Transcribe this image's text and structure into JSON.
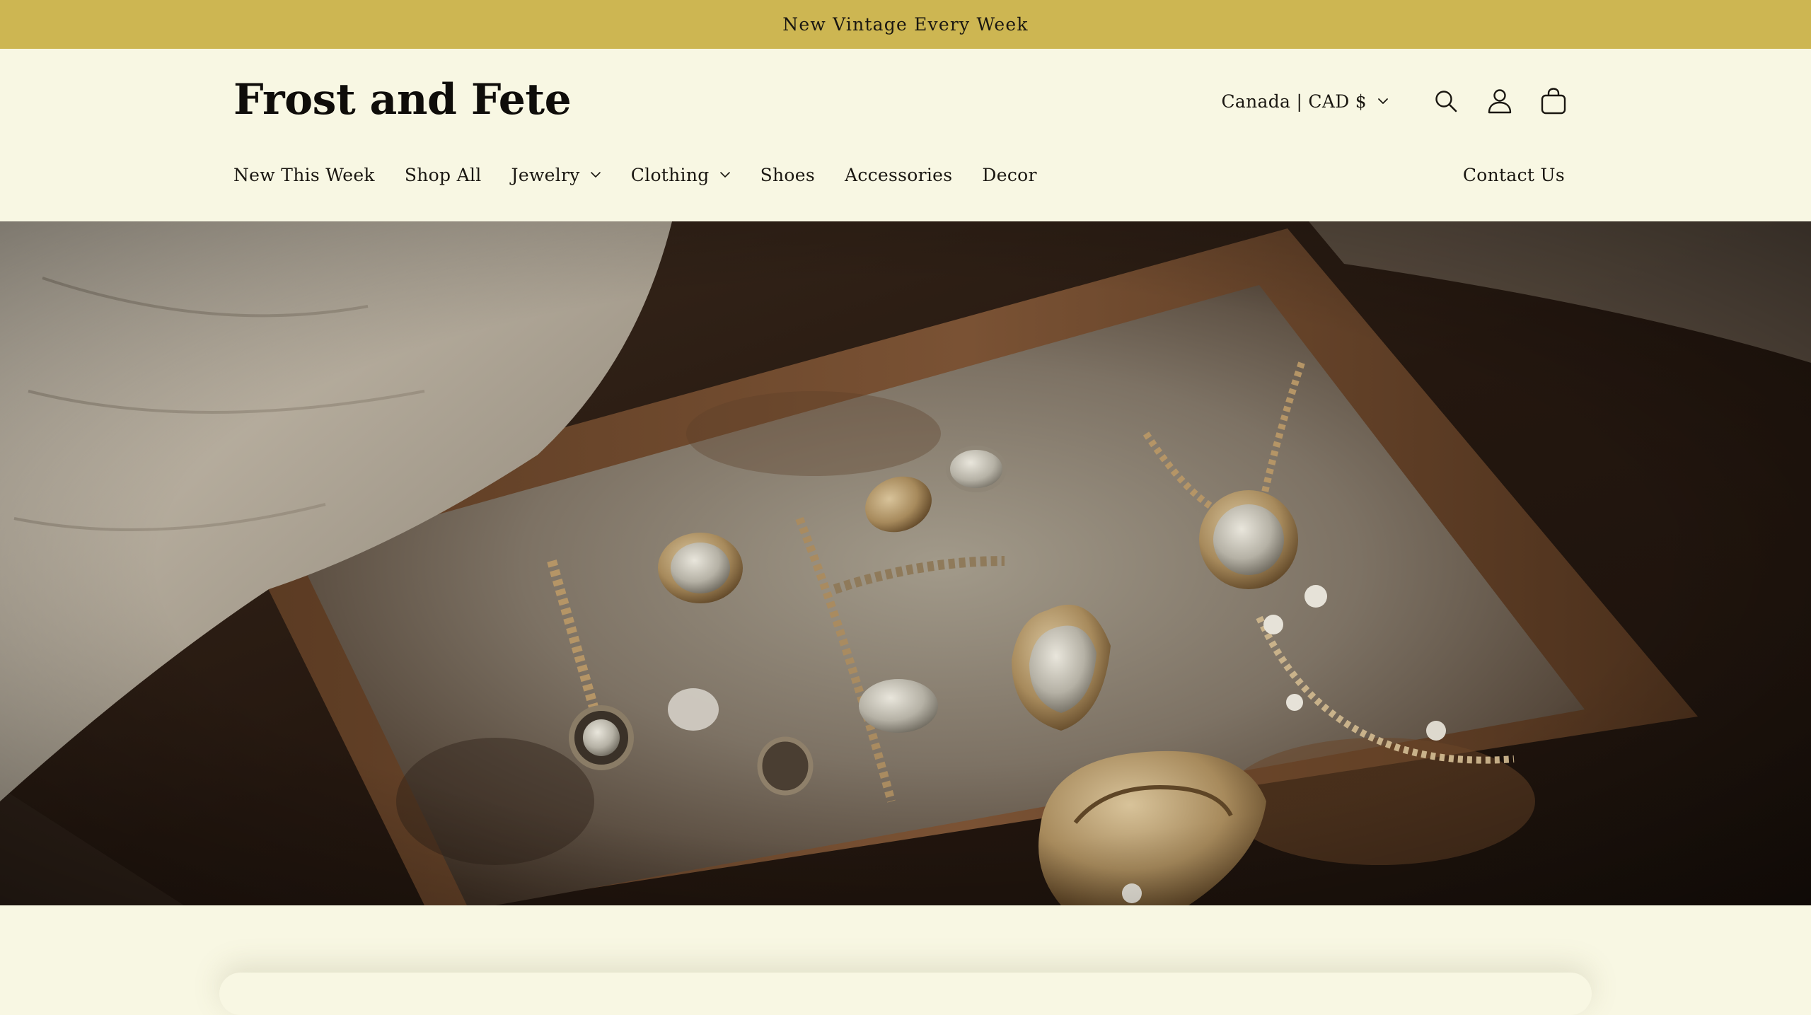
{
  "announcement": {
    "text": "New Vintage Every Week"
  },
  "header": {
    "logo": "Frost and Fete",
    "country_selector": "Canada | CAD $",
    "icons": [
      "search-icon",
      "account-icon",
      "cart-icon"
    ]
  },
  "nav": {
    "items": [
      {
        "label": "New This Week",
        "has_dropdown": false
      },
      {
        "label": "Shop All",
        "has_dropdown": false
      },
      {
        "label": "Jewelry",
        "has_dropdown": true
      },
      {
        "label": "Clothing",
        "has_dropdown": true
      },
      {
        "label": "Shoes",
        "has_dropdown": false
      },
      {
        "label": "Accessories",
        "has_dropdown": false
      },
      {
        "label": "Decor",
        "has_dropdown": false
      }
    ],
    "right_item": "Contact Us"
  },
  "colors": {
    "announcement_bg": "#cdb652",
    "page_bg": "#f8f7e3",
    "text": "#1a1711"
  }
}
